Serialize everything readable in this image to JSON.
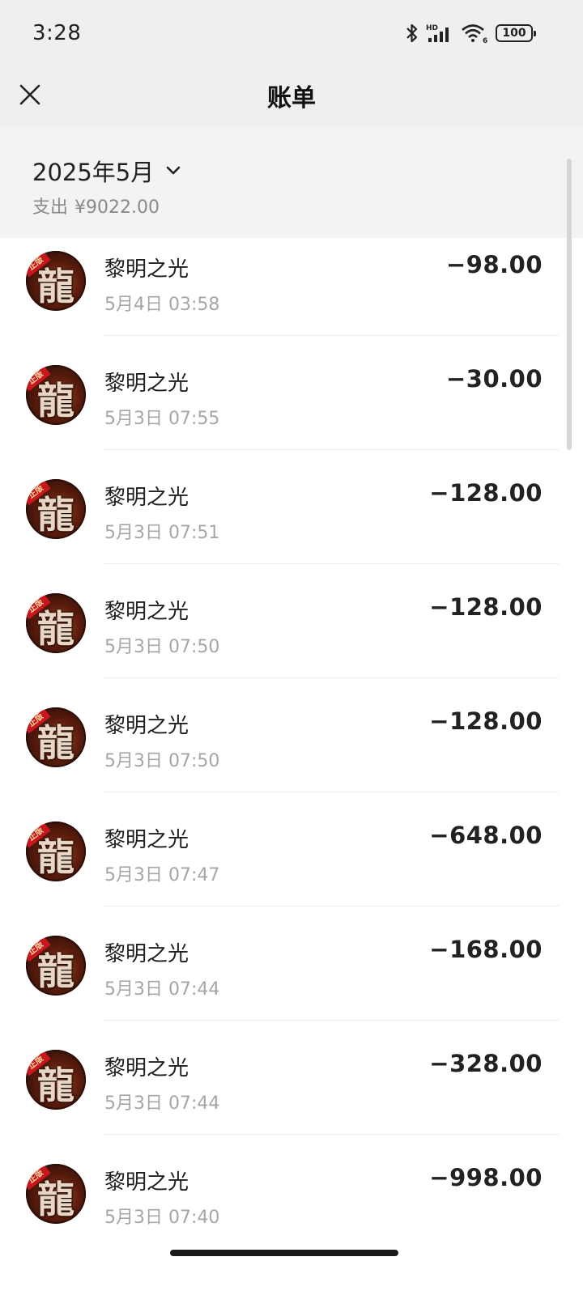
{
  "status_bar": {
    "time": "3:28",
    "battery_level": "100",
    "icons": [
      "bluetooth-icon",
      "hd-signal-icon",
      "wifi-icon",
      "battery-icon"
    ]
  },
  "header": {
    "title": "账单",
    "close_icon": "close-icon"
  },
  "summary": {
    "month": "2025年5月",
    "expense_label": "支出",
    "expense_amount": "¥9022.00"
  },
  "transactions": [
    {
      "avatar_char": "龍",
      "avatar_badge": "正版",
      "merchant": "黎明之光",
      "time": "5月4日 03:58",
      "amount": "−98.00"
    },
    {
      "avatar_char": "龍",
      "avatar_badge": "正版",
      "merchant": "黎明之光",
      "time": "5月3日 07:55",
      "amount": "−30.00"
    },
    {
      "avatar_char": "龍",
      "avatar_badge": "正版",
      "merchant": "黎明之光",
      "time": "5月3日 07:51",
      "amount": "−128.00"
    },
    {
      "avatar_char": "龍",
      "avatar_badge": "正版",
      "merchant": "黎明之光",
      "time": "5月3日 07:50",
      "amount": "−128.00"
    },
    {
      "avatar_char": "龍",
      "avatar_badge": "正版",
      "merchant": "黎明之光",
      "time": "5月3日 07:50",
      "amount": "−128.00"
    },
    {
      "avatar_char": "龍",
      "avatar_badge": "正版",
      "merchant": "黎明之光",
      "time": "5月3日 07:47",
      "amount": "−648.00"
    },
    {
      "avatar_char": "龍",
      "avatar_badge": "正版",
      "merchant": "黎明之光",
      "time": "5月3日 07:44",
      "amount": "−168.00"
    },
    {
      "avatar_char": "龍",
      "avatar_badge": "正版",
      "merchant": "黎明之光",
      "time": "5月3日 07:44",
      "amount": "−328.00"
    },
    {
      "avatar_char": "龍",
      "avatar_badge": "正版",
      "merchant": "黎明之光",
      "time": "5月3日 07:40",
      "amount": "−998.00"
    }
  ]
}
